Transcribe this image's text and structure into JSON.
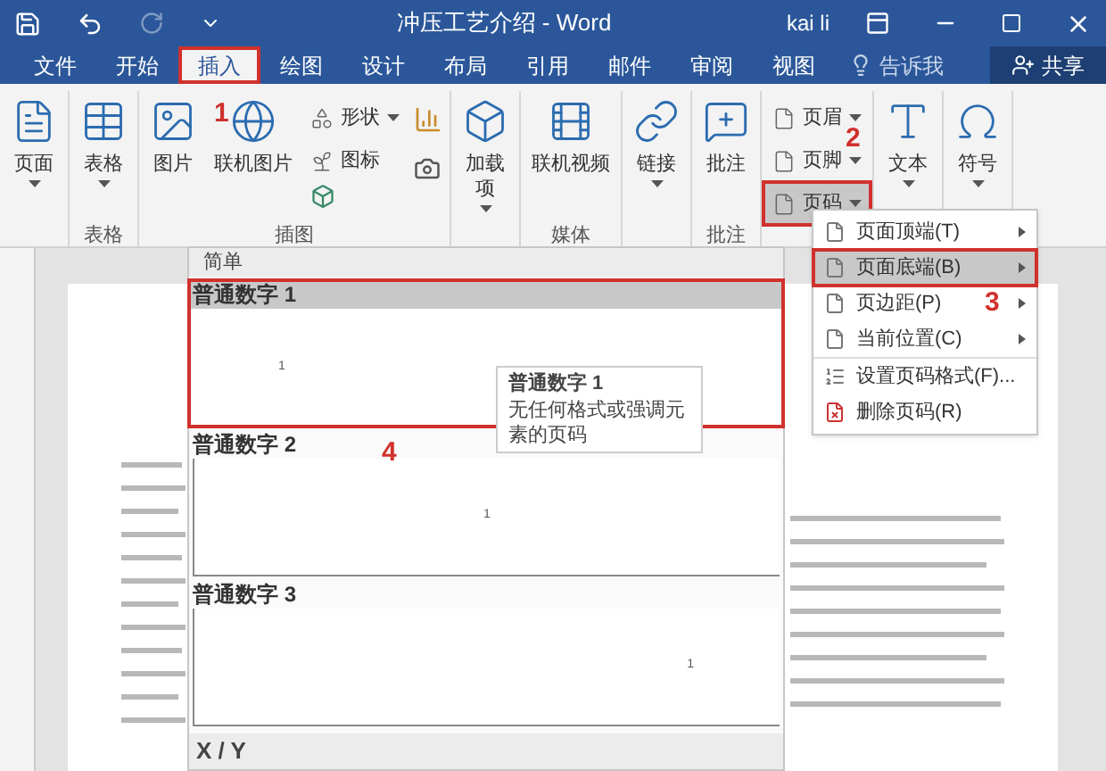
{
  "window": {
    "title": "冲压工艺介绍 - Word",
    "user": "kai li"
  },
  "tabs": [
    {
      "label": "文件",
      "selected": false
    },
    {
      "label": "开始",
      "selected": false
    },
    {
      "label": "插入",
      "selected": true
    },
    {
      "label": "绘图",
      "selected": false
    },
    {
      "label": "设计",
      "selected": false
    },
    {
      "label": "布局",
      "selected": false
    },
    {
      "label": "引用",
      "selected": false
    },
    {
      "label": "邮件",
      "selected": false
    },
    {
      "label": "审阅",
      "selected": false
    },
    {
      "label": "视图",
      "selected": false
    }
  ],
  "tell_me": "告诉我",
  "share": "共享",
  "ribbon": {
    "groups": [
      {
        "items": [
          {
            "kind": "large",
            "label": "页面",
            "dropdown": true
          }
        ]
      },
      {
        "label": "表格",
        "items": [
          {
            "kind": "large",
            "label": "表格",
            "dropdown": true
          }
        ]
      },
      {
        "label": "插图",
        "items": [
          {
            "kind": "large",
            "label": "图片",
            "dropdown": false
          },
          {
            "kind": "large",
            "label": "联机图片",
            "dropdown": false
          },
          {
            "kind": "small",
            "label": "形状",
            "dropdown": true
          },
          {
            "kind": "small",
            "label": "图标",
            "dropdown": false
          }
        ]
      },
      {
        "items": [
          {
            "kind": "large",
            "label": "加载项",
            "dropdown": true
          }
        ]
      },
      {
        "label": "媒体",
        "items": [
          {
            "kind": "large",
            "label": "联机视频",
            "dropdown": false
          }
        ]
      },
      {
        "items": [
          {
            "kind": "large",
            "label": "链接",
            "dropdown": true
          }
        ]
      },
      {
        "label": "批注",
        "items": [
          {
            "kind": "large",
            "label": "批注",
            "dropdown": false
          }
        ]
      },
      {
        "items": [
          {
            "kind": "small",
            "label": "页眉",
            "dropdown": true,
            "expanded": false
          },
          {
            "kind": "small",
            "label": "页脚",
            "dropdown": true,
            "expanded": false
          },
          {
            "kind": "small",
            "label": "页码",
            "dropdown": true,
            "expanded": true
          }
        ]
      },
      {
        "items": [
          {
            "kind": "large",
            "label": "文本",
            "dropdown": true
          }
        ]
      },
      {
        "items": [
          {
            "kind": "large",
            "label": "符号",
            "dropdown": true
          }
        ]
      }
    ]
  },
  "page_number_menu": [
    {
      "label": "页面顶端(T)",
      "submenu": true,
      "selected": false
    },
    {
      "label": "页面底端(B)",
      "submenu": true,
      "selected": true
    },
    {
      "label": "页边距(P)",
      "submenu": true,
      "selected": false
    },
    {
      "label": "当前位置(C)",
      "submenu": true,
      "selected": false
    },
    {
      "label": "设置页码格式(F)...",
      "submenu": false,
      "selected": false
    },
    {
      "label": "删除页码(R)",
      "submenu": false,
      "selected": false
    }
  ],
  "gallery": {
    "section": "简单",
    "items": [
      {
        "title": "普通数字 1",
        "number": "1",
        "kind": "left",
        "selected": true
      },
      {
        "title": "普通数字 2",
        "number": "1",
        "kind": "center",
        "selected": false
      },
      {
        "title": "普通数字 3",
        "number": "1",
        "kind": "right",
        "selected": false
      }
    ],
    "next_section": "X / Y"
  },
  "tooltip": {
    "title": "普通数字 1",
    "text": "无任何格式或强调元素的页码"
  },
  "annotations": [
    {
      "label": "1"
    },
    {
      "label": "2"
    },
    {
      "label": "3"
    },
    {
      "label": "4"
    }
  ]
}
